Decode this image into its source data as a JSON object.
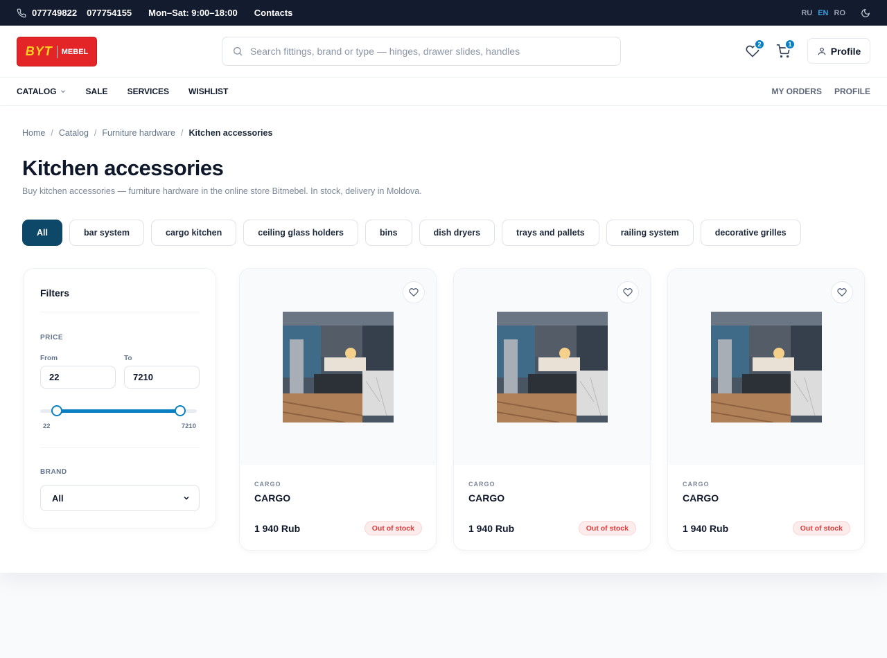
{
  "topbar": {
    "phone1": "077749822",
    "phone2": "077754155",
    "hours": "Mon–Sat: 9:00–18:00",
    "contacts": "Contacts",
    "languages": [
      "RU",
      "EN",
      "RO"
    ],
    "active_language": "EN"
  },
  "header": {
    "logo_byt": "BYT",
    "logo_mebel": "MEBEL",
    "search_placeholder": "Search fittings, brand or type — hinges, drawer slides, handles",
    "wishlist_count": "2",
    "cart_count": "1",
    "profile_label": "Profile"
  },
  "nav": {
    "items": [
      "CATALOG",
      "SALE",
      "SERVICES",
      "WISHLIST"
    ],
    "right": [
      "MY ORDERS",
      "PROFILE"
    ]
  },
  "breadcrumb": [
    "Home",
    "Catalog",
    "Furniture hardware",
    "Kitchen accessories"
  ],
  "page": {
    "title": "Kitchen accessories",
    "subtitle": "Buy kitchen accessories — furniture hardware in the online store Bitmebel. In stock, delivery in Moldova."
  },
  "chips": [
    "All",
    "bar system",
    "cargo kitchen",
    "ceiling glass holders",
    "bins",
    "dish dryers",
    "trays and pallets",
    "railing system",
    "decorative grilles"
  ],
  "filters": {
    "title": "Filters",
    "price_label": "PRICE",
    "from_label": "From",
    "to_label": "To",
    "from_value": "22",
    "to_value": "7210",
    "slider_min": "22",
    "slider_max": "7210",
    "range_low_fraction": 0.0,
    "range_high_fraction": 1.0,
    "brand_label": "BRAND",
    "brand_value": "All"
  },
  "products": [
    {
      "brand": "CARGO",
      "name": "CARGO",
      "price": "1 940 Rub",
      "stock": "Out of stock"
    },
    {
      "brand": "CARGO",
      "name": "CARGO",
      "price": "1 940 Rub",
      "stock": "Out of stock"
    },
    {
      "brand": "CARGO",
      "name": "CARGO",
      "price": "1 940 Rub",
      "stock": "Out of stock"
    }
  ],
  "colors": {
    "accent": "#0a7fc2",
    "chip_active": "#0e4868",
    "out_of_stock": "#dc3d3d",
    "logo_red": "#e42528"
  }
}
